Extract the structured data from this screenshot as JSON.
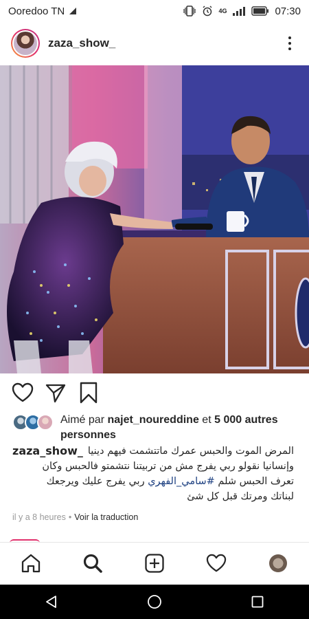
{
  "status_bar": {
    "carrier": "Ooredoo TN",
    "network": "4G",
    "time": "07:30"
  },
  "post": {
    "username": "zaza_show_",
    "more_icon": "more-vertical-icon",
    "image_alt": "Photo of a woman in a sequined dress shaking hands with a man in a suit at a talk-show desk",
    "likes": {
      "prefix": "Aimé par",
      "user": "najet_noureddine",
      "connector": "et",
      "count_text": "5 000 autres personnes"
    },
    "caption": {
      "username": "zaza_show_",
      "line1": "المرض الموت والحبس عمرك ماتتشمت فيهم دينيا",
      "line2": "وإنسانيا  نقولو ربي يفرج  مش من تربيتنا نتشمتو فالحبس وكان",
      "line3_before": "تعرف الحبس شلم ",
      "hashtag": "#سامي_الفهري",
      "line3_after": "  ربي يفرج عليك ويرجعك",
      "line4": "لبناتك ومرتك قبل كل شئ"
    },
    "timestamp": "il y a 8 heures",
    "separator": "•",
    "translate": "Voir la traduction"
  },
  "icons": {
    "like": "heart-icon",
    "share": "send-icon",
    "save": "bookmark-icon",
    "home": "home-icon",
    "search": "search-icon",
    "add": "add-post-icon",
    "activity": "heart-icon",
    "profile": "profile-avatar"
  },
  "colors": {
    "text": "#262626",
    "muted": "#999999",
    "hashtag": "#1c3f80",
    "story_ring_start": "#f9a13a",
    "story_ring_end": "#c13584"
  }
}
